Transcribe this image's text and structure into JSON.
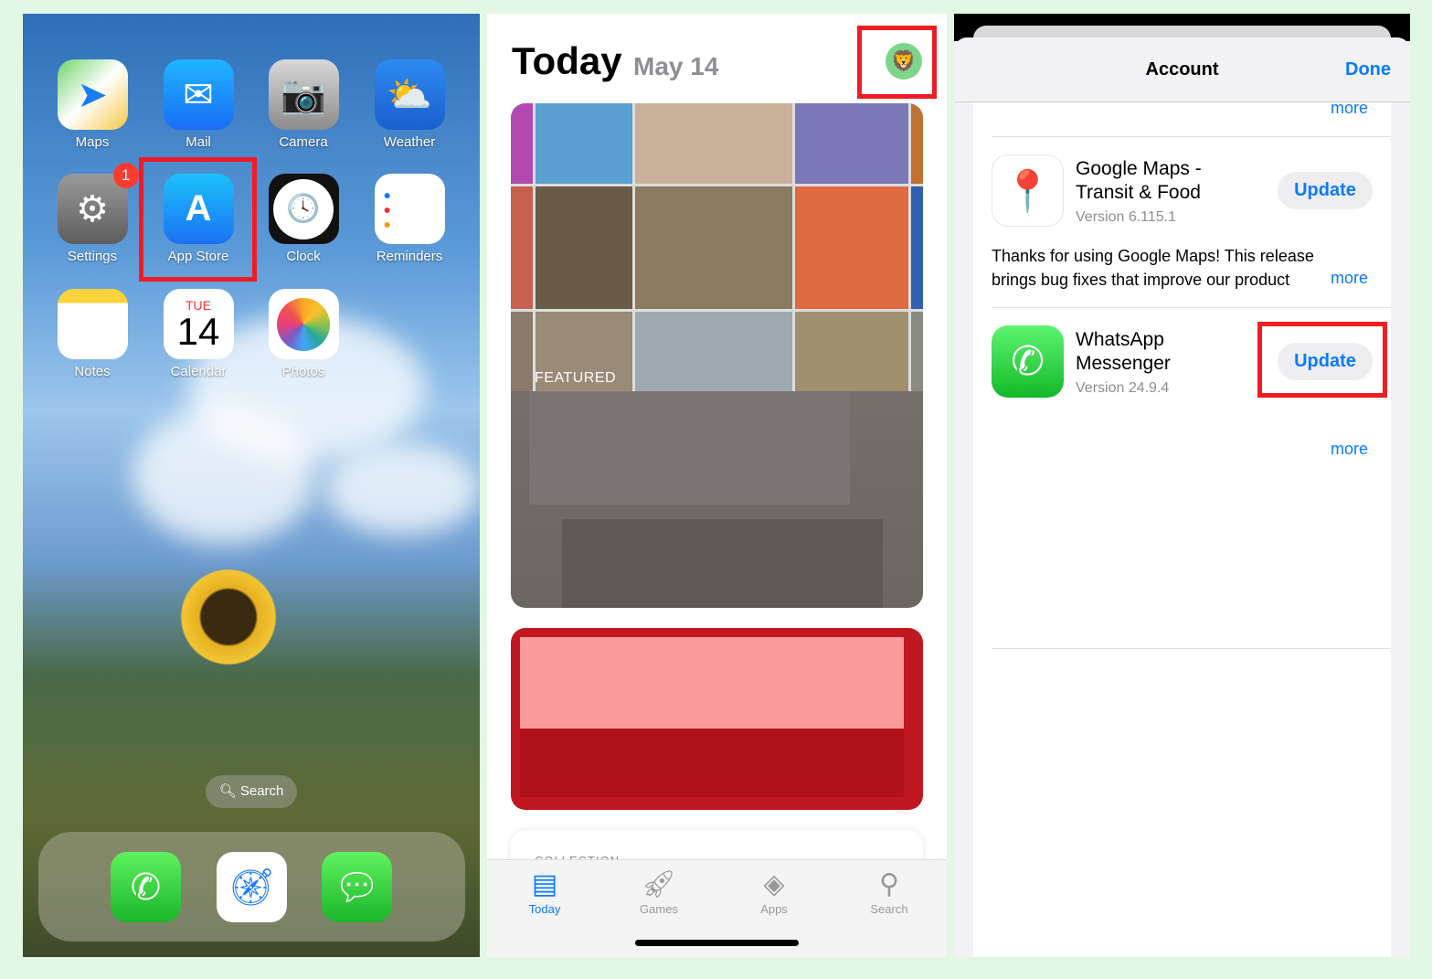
{
  "home": {
    "apps": [
      {
        "label": "Maps",
        "icon": "maps-icon"
      },
      {
        "label": "Mail",
        "icon": "mail-icon"
      },
      {
        "label": "Camera",
        "icon": "camera-icon"
      },
      {
        "label": "Weather",
        "icon": "weather-icon"
      },
      {
        "label": "Settings",
        "icon": "settings-icon",
        "badge": "1"
      },
      {
        "label": "App Store",
        "icon": "app-store-icon"
      },
      {
        "label": "Clock",
        "icon": "clock-icon"
      },
      {
        "label": "Reminders",
        "icon": "reminders-icon"
      },
      {
        "label": "Notes",
        "icon": "notes-icon"
      },
      {
        "label": "Calendar",
        "icon": "calendar-icon",
        "day": "TUE",
        "date": "14"
      },
      {
        "label": "Photos",
        "icon": "photos-icon"
      }
    ],
    "search_label": "Search",
    "dock": [
      "phone-icon",
      "safari-icon",
      "messages-icon"
    ]
  },
  "today": {
    "title": "Today",
    "date": "May 14",
    "featured_label": "FEATURED",
    "collection_label": "COLLECTION",
    "tabs": [
      {
        "label": "Today",
        "active": true
      },
      {
        "label": "Games"
      },
      {
        "label": "Apps"
      },
      {
        "label": "Search"
      }
    ]
  },
  "account": {
    "title": "Account",
    "done": "Done",
    "more": "more",
    "updates": [
      {
        "name_line1": "Google Maps -",
        "name_line2": "Transit & Food",
        "version": "Version 6.115.1",
        "button": "Update",
        "notes_line1": "Thanks for using Google Maps! This release",
        "notes_line2": "brings bug fixes that improve our product"
      },
      {
        "name_line1": "WhatsApp",
        "name_line2": "Messenger",
        "version": "Version 24.9.4",
        "button": "Update"
      }
    ]
  },
  "colors": {
    "accent": "#0a7aff",
    "highlight": "#f01c24",
    "background": "#e2f8e5"
  }
}
